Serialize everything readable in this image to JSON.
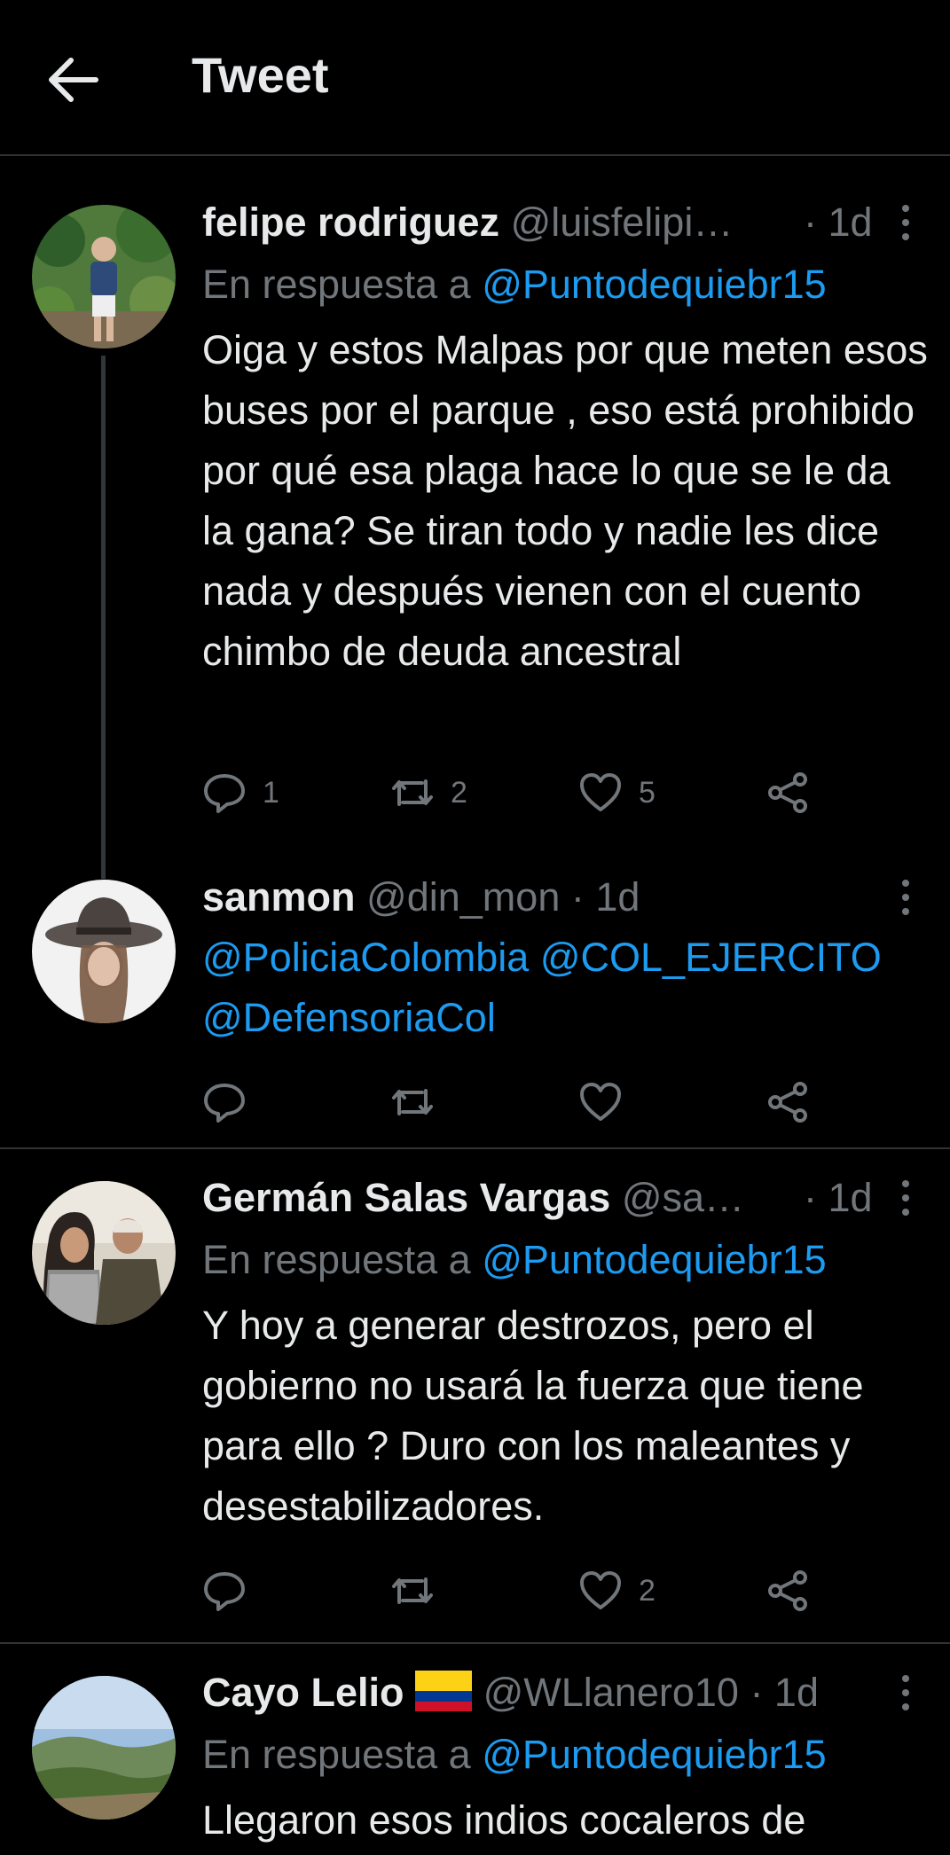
{
  "header": {
    "title": "Tweet"
  },
  "tweets": [
    {
      "name": "felipe rodriguez",
      "handle": "@luisfelipi…",
      "time": "· 1d",
      "reply_prefix": "En respuesta a ",
      "reply_to": "@Puntodequiebr15",
      "text": "Oiga y estos Malpas por que meten esos buses por el parque , eso está prohibido por qué esa plaga hace lo que se le da la gana? Se tiran todo y nadie les dice nada y después vienen con el cuento chimbo de deuda ancestral",
      "replies": "1",
      "retweets": "2",
      "likes": "5"
    },
    {
      "name": "sanmon",
      "handle": "@din_mon",
      "time": "· 1d",
      "mentions_line1": "@PoliciaColombia @COL_EJERCITO",
      "mentions_line2": "@DefensoriaCol"
    },
    {
      "name": "Germán Salas Vargas",
      "handle": "@sa…",
      "time": "· 1d",
      "reply_prefix": "En respuesta a ",
      "reply_to": "@Puntodequiebr15",
      "text": "Y hoy a generar destrozos, pero el gobierno no usará la fuerza que tiene para ello  ? Duro con los maleantes y desestabilizadores.",
      "likes": "2"
    },
    {
      "name": "Cayo Lelio",
      "handle": "@WLlanero10",
      "time": "· 1d",
      "reply_prefix": "En respuesta a ",
      "reply_to": "@Puntodequiebr15",
      "text": "Llegaron esos indios cocaleros de"
    }
  ],
  "colors": {
    "background": "#000000",
    "text": "#e7e9ea",
    "muted": "#71767b",
    "link": "#1d9bf0",
    "divider": "#2f3336"
  }
}
